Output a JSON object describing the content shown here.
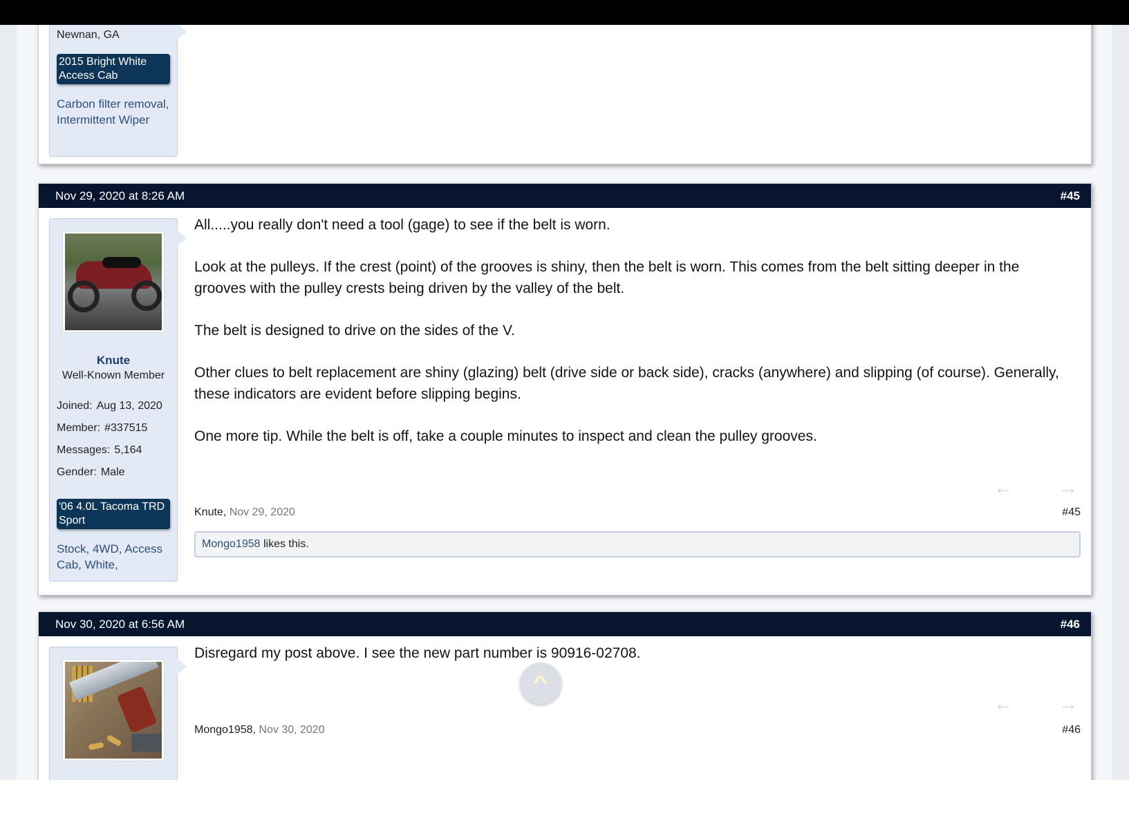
{
  "previous_post": {
    "location": "Newnan, GA",
    "vehicle": "2015 Bright White Access Cab",
    "vehicle_mods": "Carbon filter removal, Intermittent Wiper"
  },
  "posts": [
    {
      "timestamp": "Nov 29, 2020 at 8:26 AM",
      "number": "#45",
      "user": {
        "name": "Knute",
        "title": "Well-Known Member",
        "avatar": "motorcycle-avatar",
        "joined_label": "Joined:",
        "joined": "Aug 13, 2020",
        "member_label": "Member:",
        "member": "#337515",
        "messages_label": "Messages:",
        "messages": "5,164",
        "gender_label": "Gender:",
        "gender": "Male",
        "vehicle": "'06 4.0L Tacoma TRD Sport",
        "vehicle_mods": "Stock, 4WD, Access Cab, White,"
      },
      "paragraphs": [
        "All.....you really don't need a tool (gage) to see if the belt is worn.",
        "Look at the pulleys. If the crest (point) of the grooves is shiny, then the belt is worn. This comes from the belt sitting deeper in the grooves with the pulley crests being driven by the valley of the belt.",
        "The belt is designed to drive on the sides of the V.",
        "Other clues to belt replacement are shiny (glazing) belt (drive side or back side), cracks (anywhere) and slipping (of course). Generally, these indicators are evident before slipping begins.",
        "One more tip. While the belt is off, take a couple minutes to inspect and clean the pulley grooves."
      ],
      "signature_name": "Knute,",
      "signature_date": "Nov 29, 2020",
      "post_ref": "#45",
      "likes": {
        "liker": "Mongo1958",
        "text": " likes this."
      }
    },
    {
      "timestamp": "Nov 30, 2020 at 6:56 AM",
      "number": "#46",
      "user": {
        "avatar": "pistol-avatar"
      },
      "paragraphs": [
        "Disregard my post above. I see the new part number is 90916-02708."
      ],
      "signature_name": "Mongo1958,",
      "signature_date": "Nov 30, 2020",
      "post_ref": "#46"
    }
  ],
  "icons": {
    "prev": "←",
    "next": "→",
    "scroll_top": "^"
  }
}
